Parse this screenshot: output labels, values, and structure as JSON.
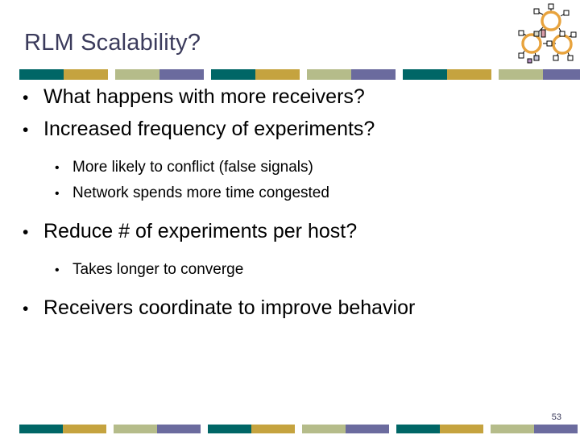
{
  "slide": {
    "title": "RLM Scalability?",
    "page_number": "53",
    "bullets": [
      {
        "level": 1,
        "text": "What happens with more receivers?",
        "marker": "•"
      },
      {
        "level": 1,
        "text": "Increased frequency of experiments?",
        "marker": "•"
      },
      {
        "level": 2,
        "text": "More likely to conflict (false signals)",
        "marker": "•"
      },
      {
        "level": 2,
        "text": "Network spends more time congested",
        "marker": "•"
      },
      {
        "level": 1,
        "text": "Reduce # of experiments per host?",
        "marker": "•"
      },
      {
        "level": 2,
        "text": "Takes longer to converge",
        "marker": "•"
      },
      {
        "level": 1,
        "text": "Receivers coordinate to improve behavior",
        "marker": "•"
      }
    ]
  },
  "decoration": {
    "top_bar_name": "top-decorative-bar",
    "bottom_bar_name": "bottom-decorative-bar",
    "segment_colors": [
      "#006666",
      "#c5a33f",
      "#b5bc8a",
      "#6b6b9e"
    ],
    "group_count_top": 4,
    "group_count_bottom": 4
  },
  "logo": {
    "name": "network-nodes-logo",
    "node_color": "#e8a33d",
    "handle_color": "#ffffff",
    "handle_border": "#000000",
    "line_color": "#000000",
    "node_count": 3
  },
  "colors": {
    "title": "#3b3b5c",
    "body_text": "#000000",
    "background": "#ffffff",
    "teal": "#006666",
    "gold": "#c5a33f",
    "sage": "#b5bc8a",
    "purple": "#6b6b9e"
  }
}
